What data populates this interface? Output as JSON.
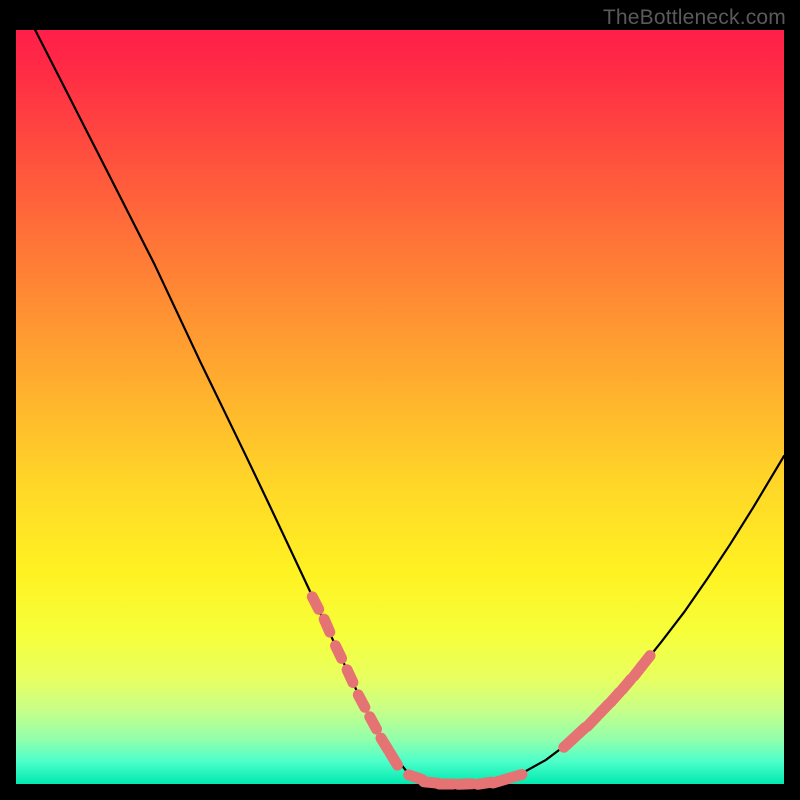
{
  "watermark": "TheBottleneck.com",
  "colors": {
    "curve_stroke": "#000000",
    "marker_fill": "#e57373",
    "marker_stroke": "#e57373"
  },
  "chart_data": {
    "type": "line",
    "title": "",
    "xlabel": "",
    "ylabel": "",
    "xlim": [
      0,
      100
    ],
    "ylim": [
      0,
      100
    ],
    "x": [
      0,
      3,
      6,
      9,
      12,
      15,
      18,
      21,
      24,
      27,
      30,
      33,
      36,
      39,
      42,
      45,
      48,
      51,
      54,
      57,
      60,
      63,
      66,
      69,
      72,
      75,
      78,
      81,
      84,
      87,
      90,
      93,
      96,
      100
    ],
    "values": [
      105,
      99,
      93,
      87,
      81,
      75,
      69,
      62.5,
      56,
      49.7,
      43.4,
      37,
      30.5,
      24,
      17.5,
      11,
      5.3,
      1.5,
      0.2,
      0,
      0,
      0.4,
      1.5,
      3.2,
      5.5,
      8.3,
      11.5,
      15,
      18.8,
      22.8,
      27.2,
      31.8,
      36.7,
      43.5
    ],
    "markers": {
      "left_arm": [
        {
          "x": 39,
          "y": 24
        },
        {
          "x": 40.5,
          "y": 21
        },
        {
          "x": 42,
          "y": 17.5
        },
        {
          "x": 43.5,
          "y": 14.3
        },
        {
          "x": 45,
          "y": 11
        },
        {
          "x": 46.5,
          "y": 8.1
        },
        {
          "x": 48,
          "y": 5.3
        },
        {
          "x": 49.2,
          "y": 3.3
        }
      ],
      "valley": [
        {
          "x": 52,
          "y": 0.9
        },
        {
          "x": 54,
          "y": 0.2
        },
        {
          "x": 56,
          "y": 0
        },
        {
          "x": 58.5,
          "y": 0
        },
        {
          "x": 61,
          "y": 0.1
        },
        {
          "x": 63,
          "y": 0.4
        },
        {
          "x": 65,
          "y": 1.0
        }
      ],
      "right_arm": [
        {
          "x": 72,
          "y": 5.5
        },
        {
          "x": 73.5,
          "y": 6.9
        },
        {
          "x": 75,
          "y": 8.3
        },
        {
          "x": 76.5,
          "y": 9.9
        },
        {
          "x": 78,
          "y": 11.5
        },
        {
          "x": 79.5,
          "y": 13.2
        },
        {
          "x": 81,
          "y": 15
        },
        {
          "x": 82,
          "y": 16.3
        }
      ]
    }
  }
}
